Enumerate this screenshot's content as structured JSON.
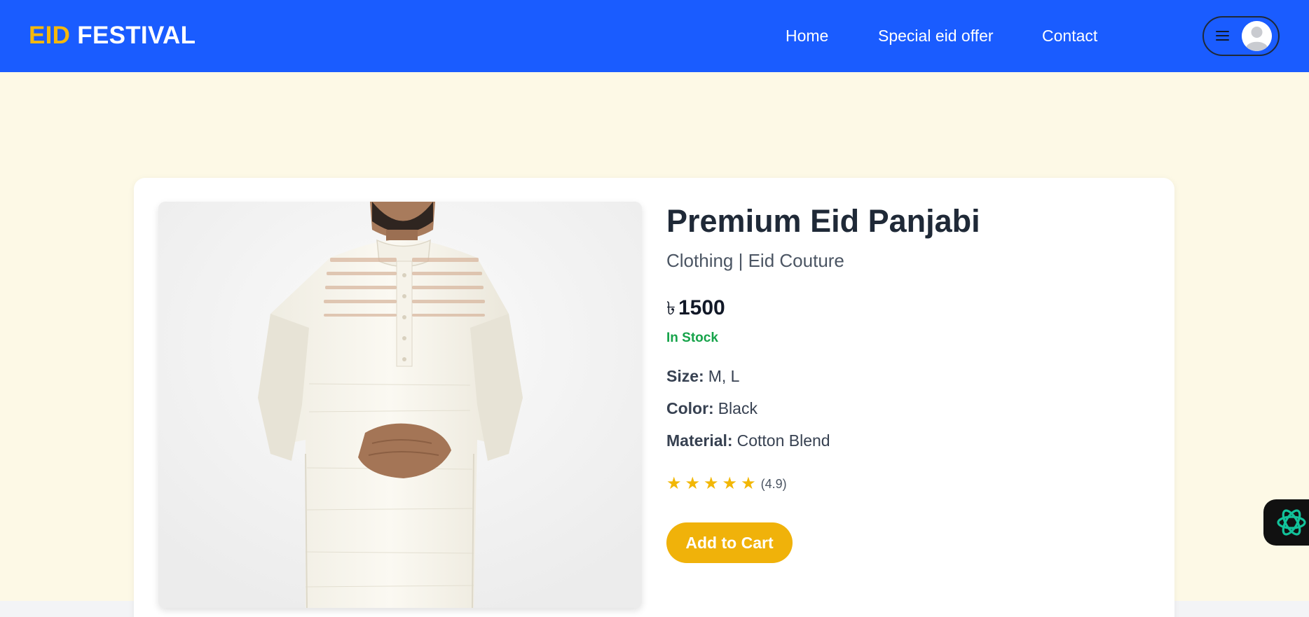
{
  "header": {
    "logo_accent": "EID",
    "logo_rest": "FESTIVAL",
    "nav": {
      "home": "Home",
      "offer": "Special eid offer",
      "contact": "Contact"
    },
    "menu_icon": "hamburger-icon",
    "avatar_icon": "user-avatar-icon"
  },
  "product": {
    "title": "Premium Eid Panjabi",
    "category": "Clothing | Eid Couture",
    "currency": "৳",
    "price": "1500",
    "stock": "In Stock",
    "size_label": "Size:",
    "size_value": "M, L",
    "color_label": "Color:",
    "color_value": "Black",
    "material_label": "Material:",
    "material_value": "Cotton Blend",
    "rating": 4.9,
    "rating_text": "(4.9)",
    "stars": "★",
    "add_to_cart": "Add to Cart"
  },
  "chat_widget": {
    "icon": "openai-icon"
  },
  "colors": {
    "nav_bg": "#1a5cff",
    "logo_accent": "#f5b80c",
    "page_bg": "#fdf9e6",
    "stock_green": "#16a34a",
    "star": "#f2b705",
    "cart_button": "#f0b20a"
  }
}
